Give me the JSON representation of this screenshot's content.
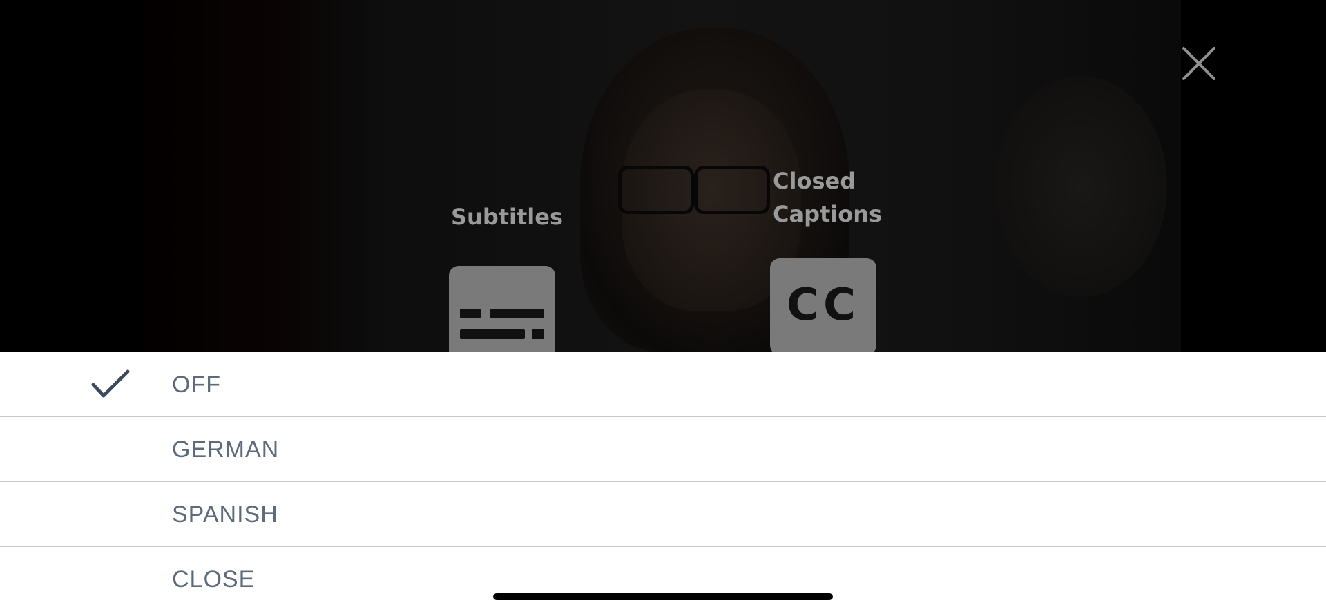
{
  "overlay": {
    "close_icon": "close-x-icon",
    "options": [
      {
        "label": "Subtitles",
        "icon": "subtitles-icon"
      },
      {
        "label": "Closed Captions",
        "icon": "closed-captions-icon",
        "icon_text": "CC"
      }
    ]
  },
  "language_menu": {
    "selected": "OFF",
    "selected_icon": "checkmark-icon",
    "items": [
      {
        "label": "OFF"
      },
      {
        "label": "GERMAN"
      },
      {
        "label": "SPANISH"
      },
      {
        "label": "CLOSE"
      }
    ]
  },
  "colors": {
    "menu_text": "#5b6b7c",
    "overlay_label": "#9a9a9a",
    "tile_bg": "#7a7a7a",
    "sheet_bg": "#ffffff",
    "divider": "#c8c8c8"
  }
}
